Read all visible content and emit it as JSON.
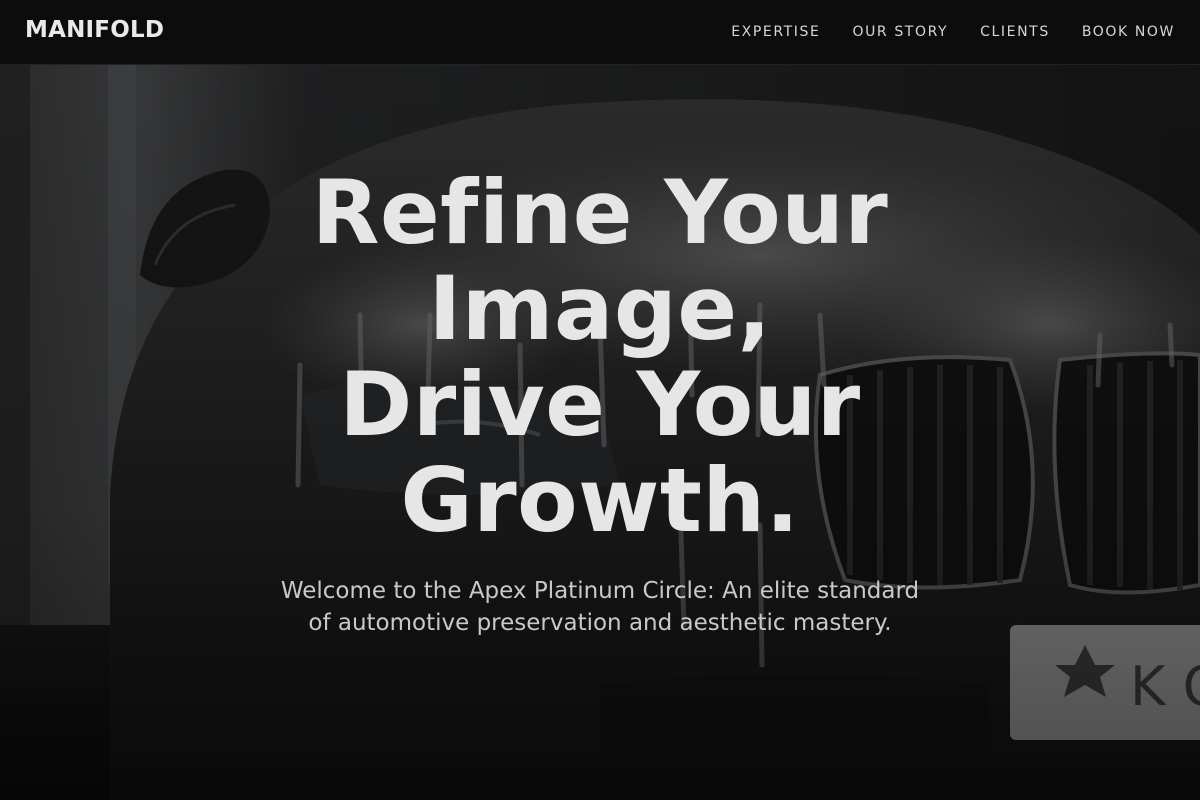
{
  "header": {
    "brand": "MANIFOLD",
    "nav": [
      {
        "label": "EXPERTISE"
      },
      {
        "label": "OUR STORY"
      },
      {
        "label": "CLIENTS"
      },
      {
        "label": "BOOK NOW"
      }
    ]
  },
  "hero": {
    "title_lines": [
      "Refine Your",
      "Image,",
      "Drive Your",
      "Growth."
    ],
    "subtitle_lines": [
      "Welcome to the Apex Platinum Circle: An elite standard",
      "of automotive preservation and aesthetic mastery."
    ],
    "background_image": "foam-covered-car-front-photo",
    "plate_text": "K O"
  },
  "colors": {
    "header_bg": "#0c0c0c",
    "text_primary": "#e6e6e6",
    "text_secondary": "#c9c9c9"
  }
}
